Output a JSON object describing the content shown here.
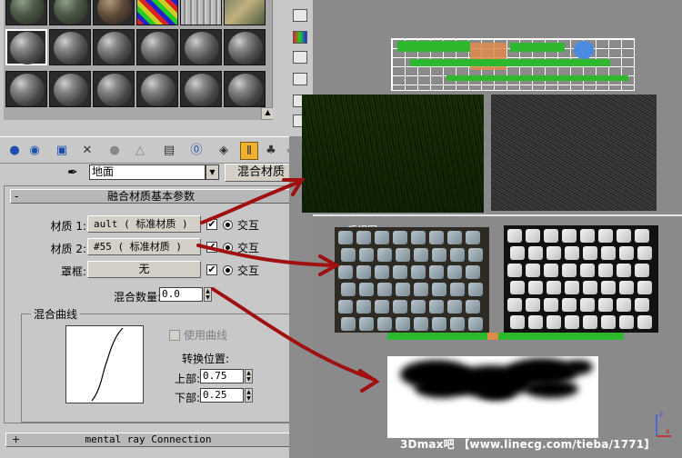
{
  "toolbar": {
    "icons": [
      "get-material-icon",
      "put-to-scene-icon",
      "assign-material-icon",
      "reset-icon",
      "make-copy-icon",
      "make-unique-icon",
      "put-library-icon",
      "material-id-icon",
      "show-map-icon",
      "show-end-result-icon",
      "go-parent-icon",
      "go-sibling-icon"
    ]
  },
  "material": {
    "name": "地面",
    "type_button": "混合材质"
  },
  "blend_rollout": {
    "sign": "-",
    "title": "融合材质基本参数",
    "rows": [
      {
        "label": "材质 1:",
        "value": "ault  ( 标准材质 )",
        "checked": "✔",
        "radio": "交互"
      },
      {
        "label": "材质 2:",
        "value": "#55  ( 标准材质 )",
        "checked": "✔",
        "radio": "交互"
      },
      {
        "label": "罩框:",
        "value": "无",
        "checked": "✔",
        "radio": "交互"
      }
    ],
    "mix_amount_label": "混合数量:",
    "mix_amount_value": "0.0",
    "curve_group": {
      "title": "混合曲线",
      "use_curve_label": "使用曲线",
      "transition_label": "转换位置:",
      "upper_label": "上部:",
      "upper_value": "0.75",
      "lower_label": "下部:",
      "lower_value": "0.25"
    }
  },
  "mental_ray": {
    "sign": "+",
    "title": "mental ray Connection"
  },
  "viewport": {
    "label": "后视图",
    "watermark": "3Dmax吧 【www.linecg.com/tieba/1771】"
  },
  "colors": {
    "panel": "#c8c8c8",
    "viewport": "#8a8a8a",
    "arrow": "#a01010",
    "active_tool": "#f0b030",
    "grid_green": "#2eb82e",
    "grid_orange": "#e08a4a"
  }
}
